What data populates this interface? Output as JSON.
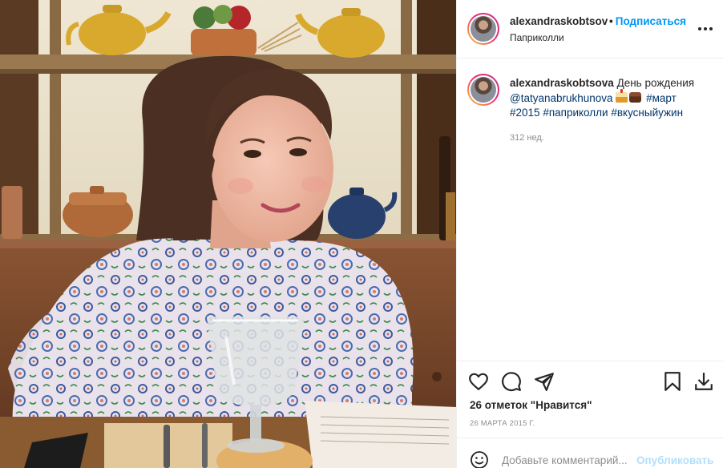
{
  "post": {
    "username": "alexandraskobtsova",
    "follow_label": "Подписаться",
    "location": "Паприколли",
    "caption": {
      "username": "alexandraskobtsova",
      "text_intro": "День рождения",
      "mention": "@tatyanabrukhunova",
      "hashtags": [
        "#март",
        "#2015",
        "#паприколли",
        "#вкусныйужин"
      ],
      "emoji": [
        "cake-emoji",
        "chocolate-cake-emoji"
      ]
    },
    "time_ago": "312 нед.",
    "likes_label": "26 отметок \"Нравится\"",
    "date": "26 МАРТА 2015 Г."
  },
  "comment": {
    "placeholder": "Добавьте комментарий...",
    "publish_label": "Опубликовать"
  },
  "icons": {
    "more": "more-options-icon",
    "like": "heart-icon",
    "comment": "comment-icon",
    "share": "share-icon",
    "save": "bookmark-icon",
    "download": "download-icon",
    "emoji": "emoji-icon"
  },
  "colors": {
    "link": "#00376b",
    "follow": "#0095f6",
    "publish_disabled": "#b2dffc",
    "muted": "#8e8e8e"
  }
}
